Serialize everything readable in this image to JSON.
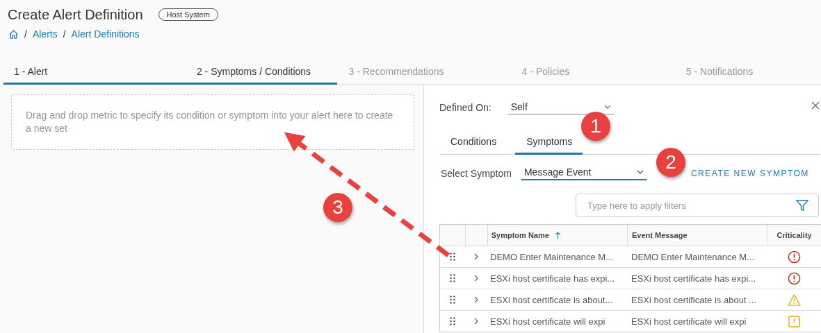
{
  "header": {
    "title": "Create Alert Definition",
    "object_type": "Host System"
  },
  "breadcrumb": [
    {
      "separator": "/",
      "label": "Alerts"
    },
    {
      "separator": "/",
      "label": "Alert Definitions"
    }
  ],
  "steps": [
    {
      "label": "1 - Alert",
      "active": true
    },
    {
      "label": "2 - Symptoms / Conditions",
      "active": true
    },
    {
      "label": "3 - Recommendations",
      "active": false
    },
    {
      "label": "4 - Policies",
      "active": false
    },
    {
      "label": "5 - Notifications",
      "active": false
    }
  ],
  "drop_zone": {
    "text": "Drag and drop metric to specify its condition or symptom into your alert here to create a new set"
  },
  "side_panel": {
    "defined_on_label": "Defined On:",
    "defined_on_value": "Self",
    "tabs": [
      {
        "label": "Conditions",
        "selected": false
      },
      {
        "label": "Symptoms",
        "selected": true
      }
    ],
    "select_symptom_label": "Select Symptom",
    "select_symptom_value": "Message Event",
    "create_link": "CREATE NEW SYMPTOM",
    "filter": {
      "placeholder": "Type here to apply filters"
    },
    "table": {
      "columns": [
        "Symptom Name",
        "Event Message",
        "Criticality"
      ],
      "rows": [
        {
          "name": "DEMO Enter Maintenance M...",
          "message": "DEMO Enter Maintenance M...",
          "kind": "critical"
        },
        {
          "name": "ESXi host certificate has expi...",
          "message": "ESXi host certificate has expi...",
          "kind": "critical"
        },
        {
          "name": "ESXi host certificate is about...",
          "message": "ESXi host certificate is about ...",
          "kind": "warning"
        },
        {
          "name": "ESXi host certificate will expi",
          "message": "ESXi host certificate will expi",
          "kind": "immediate"
        }
      ]
    }
  },
  "annotations": [
    "1",
    "2",
    "3"
  ]
}
